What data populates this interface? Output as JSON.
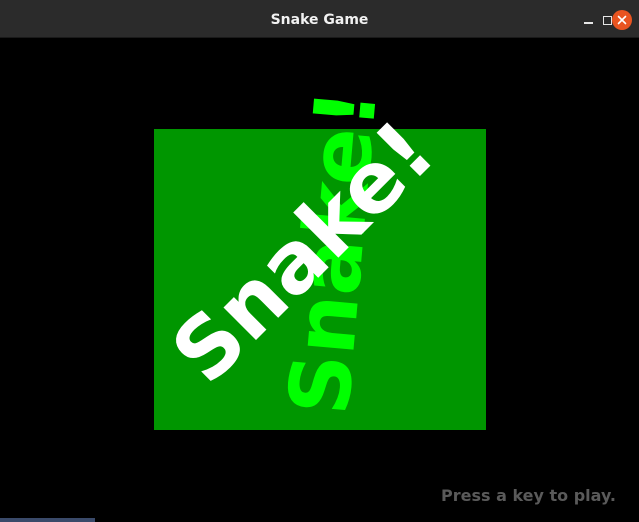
{
  "window": {
    "title": "Snake Game"
  },
  "game": {
    "rotated_text_white": "Snake!",
    "rotated_text_lime": "Snake!",
    "prompt": "Press a key to play."
  },
  "colors": {
    "background": "#000000",
    "green_square": "#009600",
    "text_white": "#ffffff",
    "text_lime": "#00ff00",
    "prompt_gray": "#5a5a5a",
    "close_button": "#e95420"
  },
  "icons": {
    "minimize": "minimize-icon",
    "maximize": "maximize-icon",
    "close": "close-icon"
  }
}
